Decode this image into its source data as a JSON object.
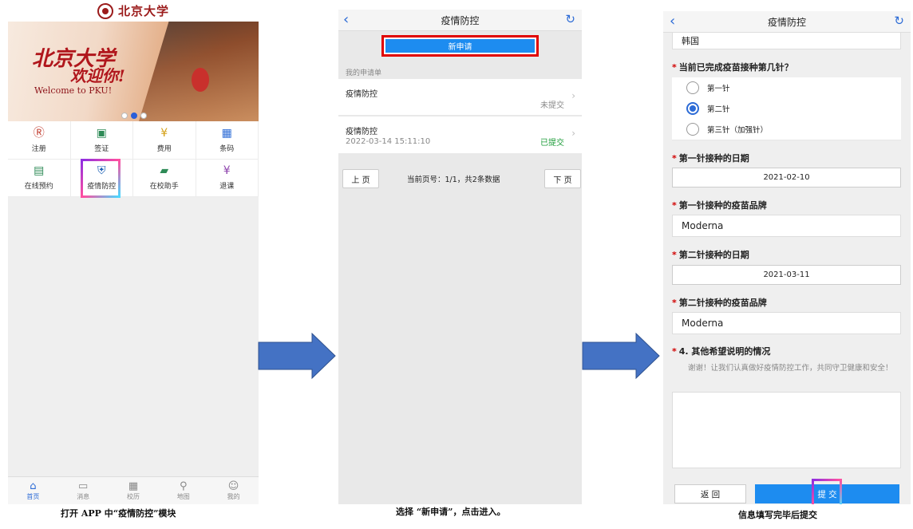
{
  "screen1": {
    "brand": "北京大学",
    "banner": {
      "line1": "北京大学",
      "line2": "欢迎你!",
      "line3": "Welcome to PKU!"
    },
    "grid": [
      {
        "label": "注册",
        "icon": "register-icon",
        "glyph": "Ⓡ"
      },
      {
        "label": "签证",
        "icon": "visa-icon",
        "glyph": "▣"
      },
      {
        "label": "费用",
        "icon": "fee-icon",
        "glyph": "¥"
      },
      {
        "label": "条码",
        "icon": "barcode-icon",
        "glyph": "▦"
      },
      {
        "label": "在线预约",
        "icon": "appointment-icon",
        "glyph": "▤"
      },
      {
        "label": "疫情防控",
        "icon": "shield-icon",
        "glyph": "⛨"
      },
      {
        "label": "在校助手",
        "icon": "assistant-icon",
        "glyph": "▰"
      },
      {
        "label": "退课",
        "icon": "drop-course-icon",
        "glyph": "¥"
      }
    ],
    "tabs": [
      {
        "label": "首页",
        "icon": "home-icon",
        "glyph": "⌂",
        "active": true
      },
      {
        "label": "消息",
        "icon": "message-icon",
        "glyph": "▭",
        "active": false
      },
      {
        "label": "校历",
        "icon": "calendar-icon",
        "glyph": "▦",
        "active": false
      },
      {
        "label": "地图",
        "icon": "map-pin-icon",
        "glyph": "⚲",
        "active": false
      },
      {
        "label": "我的",
        "icon": "user-icon",
        "glyph": "☺",
        "active": false
      }
    ],
    "caption": "打开 APP 中“疫情防控”模块"
  },
  "screen2": {
    "title": "疫情防控",
    "new_button": "新申请",
    "section": "我的申请单",
    "rows": [
      {
        "title": "疫情防控",
        "date": "",
        "status": "未提交",
        "status_color": "#888888"
      },
      {
        "title": "疫情防控",
        "date": "2022-03-14 15:11:10",
        "status": "已提交",
        "status_color": "#1e9c3a"
      }
    ],
    "prev": "上 页",
    "next": "下 页",
    "page_info": "当前页号：1/1，共2条数据",
    "caption": "选择 “新申请”，点击进入。"
  },
  "screen3": {
    "title": "疫情防控",
    "country_value": "韩国",
    "q_dose": "当前已完成疫苗接种第几针？",
    "dose_options": [
      "第一针",
      "第二针",
      "第三针（加强针）"
    ],
    "dose_selected": 1,
    "q_date1": "第一针接种的日期",
    "date1": "2021-02-10",
    "q_brand1": "第一针接种的疫苗品牌",
    "brand1": "Moderna",
    "q_date2": "第二针接种的日期",
    "date2": "2021-03-11",
    "q_brand2": "第二针接种的疫苗品牌",
    "brand2": "Moderna",
    "q_other": "4. 其他希望说明的情况",
    "hint": "谢谢！让我们认真做好疫情防控工作，共同守卫健康和安全！",
    "back_button": "返 回",
    "submit_button": "提 交",
    "caption": "信息填写完毕后提交"
  },
  "colors": {
    "accent": "#2c6bd6",
    "submit": "#1d8cf0",
    "highlight_red": "#e00000",
    "arrow": "#4472c4"
  }
}
